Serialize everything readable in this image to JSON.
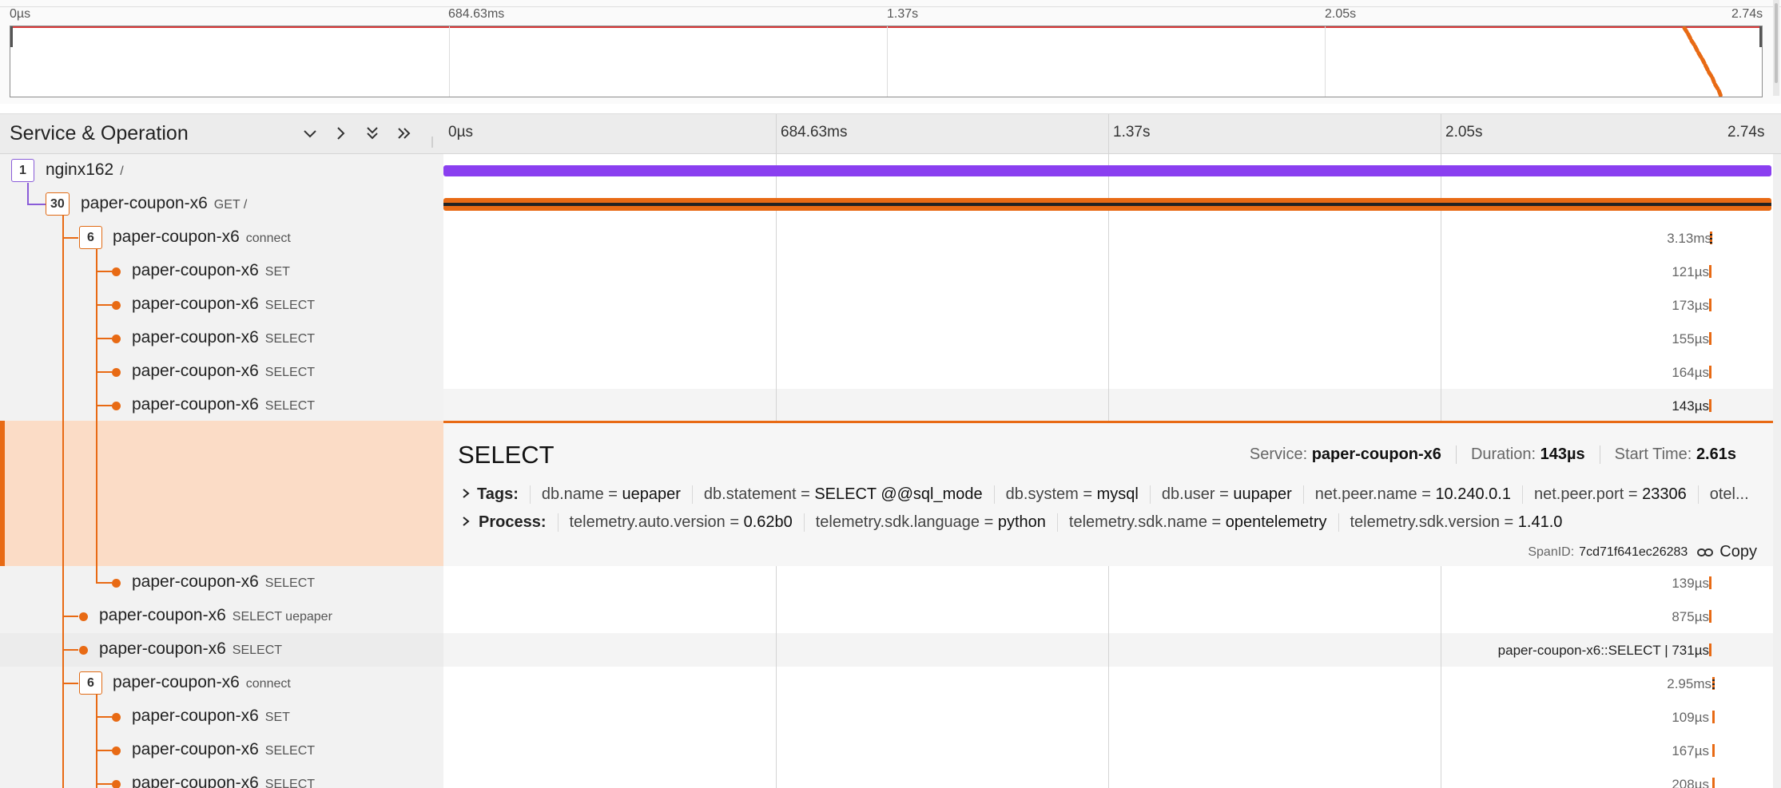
{
  "minimap": {
    "ticks": [
      "0µs",
      "684.63ms",
      "1.37s",
      "2.05s",
      "2.74s"
    ]
  },
  "header": {
    "title": "Service & Operation",
    "ticks": [
      "0µs",
      "684.63ms",
      "1.37s",
      "2.05s",
      "2.74s"
    ],
    "controls": [
      "collapse-one-icon",
      "expand-one-icon",
      "collapse-all-icon",
      "expand-all-icon"
    ]
  },
  "rows": [
    {
      "badge": "1",
      "service": "nginx162",
      "op": "/"
    },
    {
      "badge": "30",
      "service": "paper-coupon-x6",
      "op": "GET /"
    },
    {
      "badge": "6",
      "service": "paper-coupon-x6",
      "op": "connect",
      "duration": "3.13ms"
    },
    {
      "service": "paper-coupon-x6",
      "op": "SET",
      "duration": "121µs"
    },
    {
      "service": "paper-coupon-x6",
      "op": "SELECT",
      "duration": "173µs"
    },
    {
      "service": "paper-coupon-x6",
      "op": "SELECT",
      "duration": "155µs"
    },
    {
      "service": "paper-coupon-x6",
      "op": "SELECT",
      "duration": "164µs"
    },
    {
      "service": "paper-coupon-x6",
      "op": "SELECT",
      "duration": "143µs"
    },
    {
      "service": "paper-coupon-x6",
      "op": "SELECT",
      "duration": "139µs"
    },
    {
      "service": "paper-coupon-x6",
      "op": "SELECT uepaper",
      "duration": "875µs"
    },
    {
      "service": "paper-coupon-x6",
      "op": "SELECT",
      "duration": "paper-coupon-x6::SELECT | 731µs"
    },
    {
      "badge": "6",
      "service": "paper-coupon-x6",
      "op": "connect",
      "duration": "2.95ms"
    },
    {
      "service": "paper-coupon-x6",
      "op": "SET",
      "duration": "109µs"
    },
    {
      "service": "paper-coupon-x6",
      "op": "SELECT",
      "duration": "167µs"
    },
    {
      "service": "paper-coupon-x6",
      "op": "SELECT",
      "duration": "208µs"
    }
  ],
  "detail": {
    "title": "SELECT",
    "service_label": "Service:",
    "service": "paper-coupon-x6",
    "duration_label": "Duration:",
    "duration": "143µs",
    "start_label": "Start Time:",
    "start": "2.61s",
    "tags_label": "Tags:",
    "tags": [
      {
        "k": "db.name",
        "v": "uepaper"
      },
      {
        "k": "db.statement",
        "v": "SELECT @@sql_mode"
      },
      {
        "k": "db.system",
        "v": "mysql"
      },
      {
        "k": "db.user",
        "v": "uupaper"
      },
      {
        "k": "net.peer.name",
        "v": "10.240.0.1"
      },
      {
        "k": "net.peer.port",
        "v": "23306"
      }
    ],
    "tags_overflow": "otel...",
    "process_label": "Process:",
    "process": [
      {
        "k": "telemetry.auto.version",
        "v": "0.62b0"
      },
      {
        "k": "telemetry.sdk.language",
        "v": "python"
      },
      {
        "k": "telemetry.sdk.name",
        "v": "opentelemetry"
      },
      {
        "k": "telemetry.sdk.version",
        "v": "1.41.0"
      }
    ],
    "spanid_label": "SpanID:",
    "spanid": "7cd71f641ec26283",
    "copy_label": "Copy"
  },
  "colors": {
    "accent": "#e86a14",
    "root": "#8a3ff0",
    "highlight": "#fbdcc6"
  }
}
